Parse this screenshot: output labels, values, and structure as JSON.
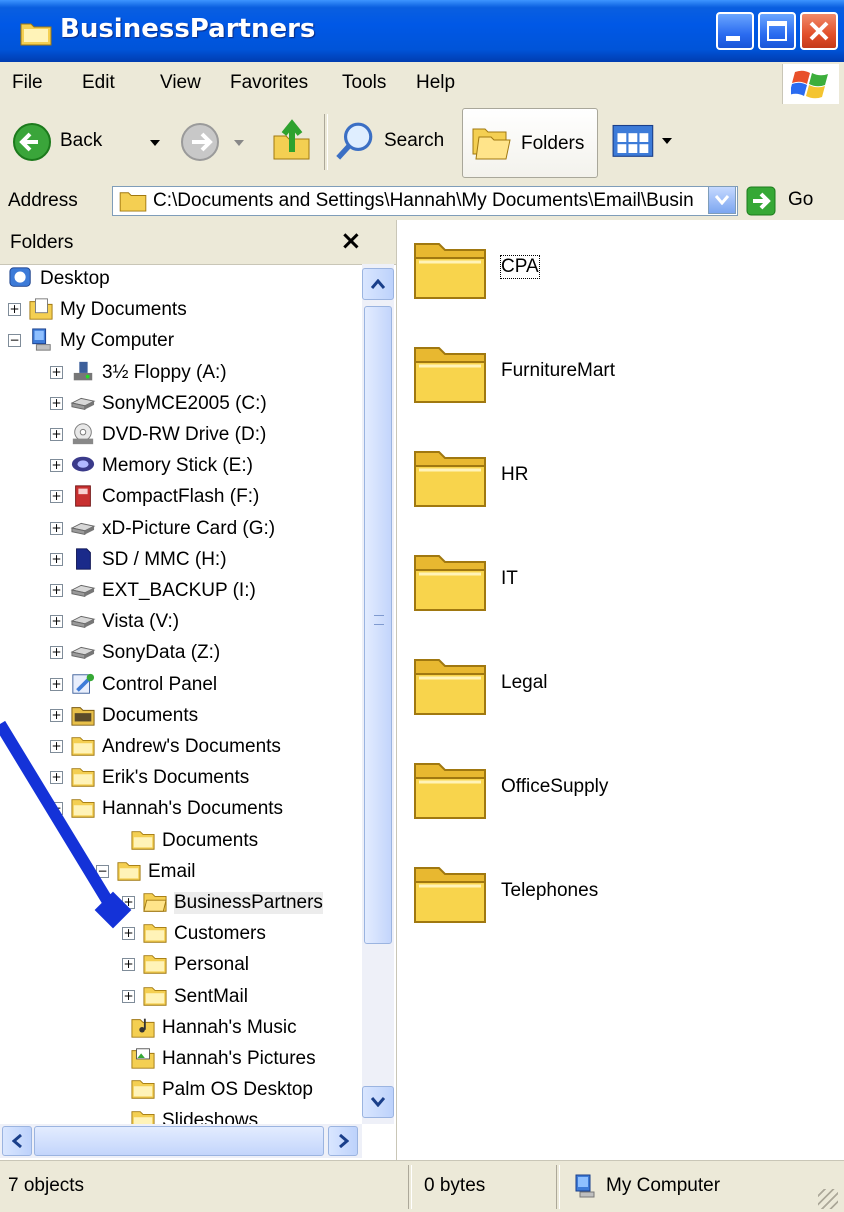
{
  "window": {
    "title": "BusinessPartners"
  },
  "menu": [
    "File",
    "Edit",
    "View",
    "Favorites",
    "Tools",
    "Help"
  ],
  "toolbar": {
    "back_label": "Back",
    "search_label": "Search",
    "folders_label": "Folders"
  },
  "address": {
    "label": "Address",
    "value": "C:\\Documents and Settings\\Hannah\\My Documents\\Email\\Busin",
    "go_label": "Go"
  },
  "folders_pane": {
    "title": "Folders",
    "close_glyph": "×",
    "tree": [
      {
        "label": "Desktop",
        "icon": "desktop-icon"
      },
      {
        "label": "My Documents",
        "icon": "my-documents-icon"
      },
      {
        "label": "My Computer",
        "icon": "my-computer-icon"
      },
      {
        "label": "3½ Floppy (A:)",
        "icon": "floppy-icon"
      },
      {
        "label": "SonyMCE2005 (C:)",
        "icon": "hard-drive-icon"
      },
      {
        "label": "DVD-RW Drive (D:)",
        "icon": "dvd-drive-icon"
      },
      {
        "label": "Memory Stick (E:)",
        "icon": "memory-stick-icon"
      },
      {
        "label": "CompactFlash (F:)",
        "icon": "compactflash-icon"
      },
      {
        "label": "xD-Picture Card (G:)",
        "icon": "card-drive-icon"
      },
      {
        "label": "SD / MMC (H:)",
        "icon": "sd-card-icon"
      },
      {
        "label": "EXT_BACKUP (I:)",
        "icon": "hard-drive-icon"
      },
      {
        "label": "Vista (V:)",
        "icon": "hard-drive-icon"
      },
      {
        "label": "SonyData (Z:)",
        "icon": "hard-drive-icon"
      },
      {
        "label": "Control Panel",
        "icon": "control-panel-icon"
      },
      {
        "label": "Documents",
        "icon": "shared-folder-icon"
      },
      {
        "label": "Andrew's Documents",
        "icon": "folder-icon"
      },
      {
        "label": "Erik's Documents",
        "icon": "folder-icon"
      },
      {
        "label": "Hannah's Documents",
        "icon": "folder-icon"
      },
      {
        "label": "Documents",
        "icon": "folder-icon"
      },
      {
        "label": "Email",
        "icon": "folder-icon"
      },
      {
        "label": "BusinessPartners",
        "icon": "folder-open-icon"
      },
      {
        "label": "Customers",
        "icon": "folder-icon"
      },
      {
        "label": "Personal",
        "icon": "folder-icon"
      },
      {
        "label": "SentMail",
        "icon": "folder-icon"
      },
      {
        "label": "Hannah's Music",
        "icon": "music-folder-icon"
      },
      {
        "label": "Hannah's Pictures",
        "icon": "pictures-folder-icon"
      },
      {
        "label": "Palm OS Desktop",
        "icon": "folder-icon"
      },
      {
        "label": "Slideshows",
        "icon": "folder-icon"
      }
    ]
  },
  "content": {
    "folders": [
      {
        "label": "CPA"
      },
      {
        "label": "FurnitureMart"
      },
      {
        "label": "HR"
      },
      {
        "label": "IT"
      },
      {
        "label": "Legal"
      },
      {
        "label": "OfficeSupply"
      },
      {
        "label": "Telephones"
      }
    ]
  },
  "statusbar": {
    "objects": "7 objects",
    "size": "0 bytes",
    "location": "My Computer"
  },
  "colors": {
    "titlebar": "#0054d8",
    "folder": "#f8d44c",
    "annotation_arrow": "#1432d8",
    "close_button": "#e2502a"
  }
}
